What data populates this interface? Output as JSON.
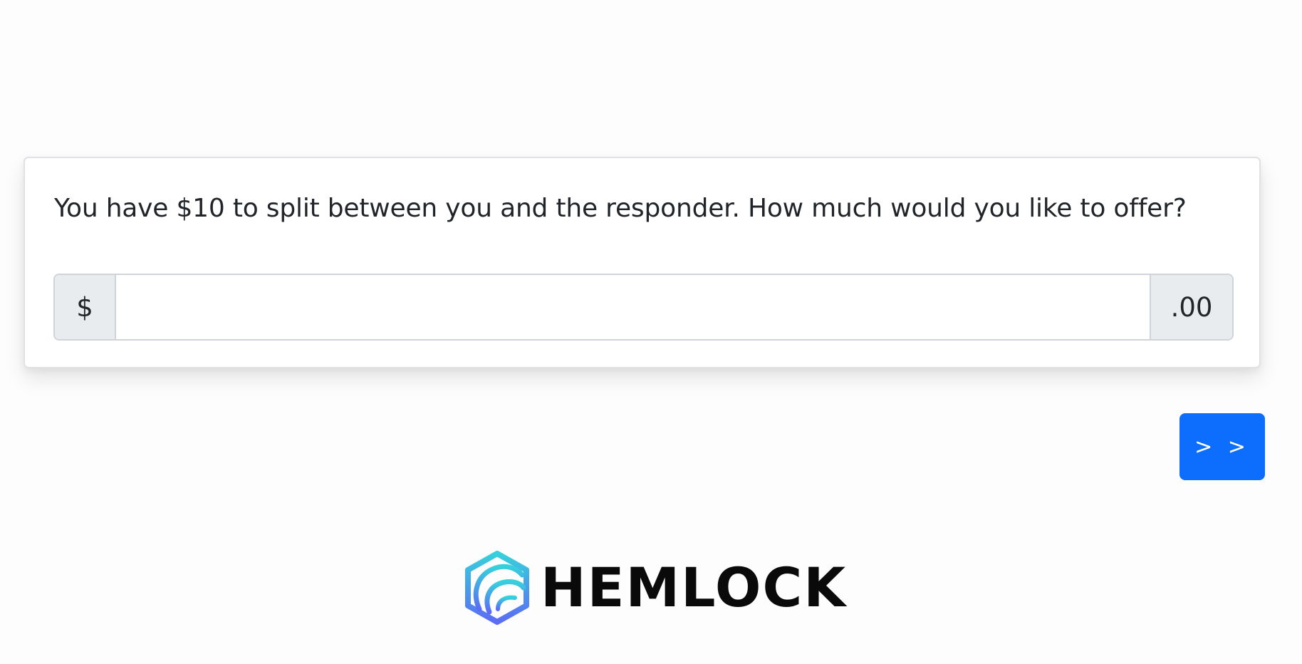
{
  "prompt": {
    "question": "You have $10 to split between you and the responder. How much would you like to offer?"
  },
  "offer_input": {
    "prefix": "$",
    "value": "",
    "suffix": ".00"
  },
  "navigation": {
    "next_label": "> >"
  },
  "branding": {
    "logo_text": "HEMLOCK",
    "logo_icon": "hemlock-hexagon-logo-icon"
  },
  "colors": {
    "accent": "#0d6efd",
    "addon_background": "#e9ecef",
    "border": "#ced4da",
    "logo_gradient_start": "#36d1dc",
    "logo_gradient_end": "#5b6cf5"
  }
}
